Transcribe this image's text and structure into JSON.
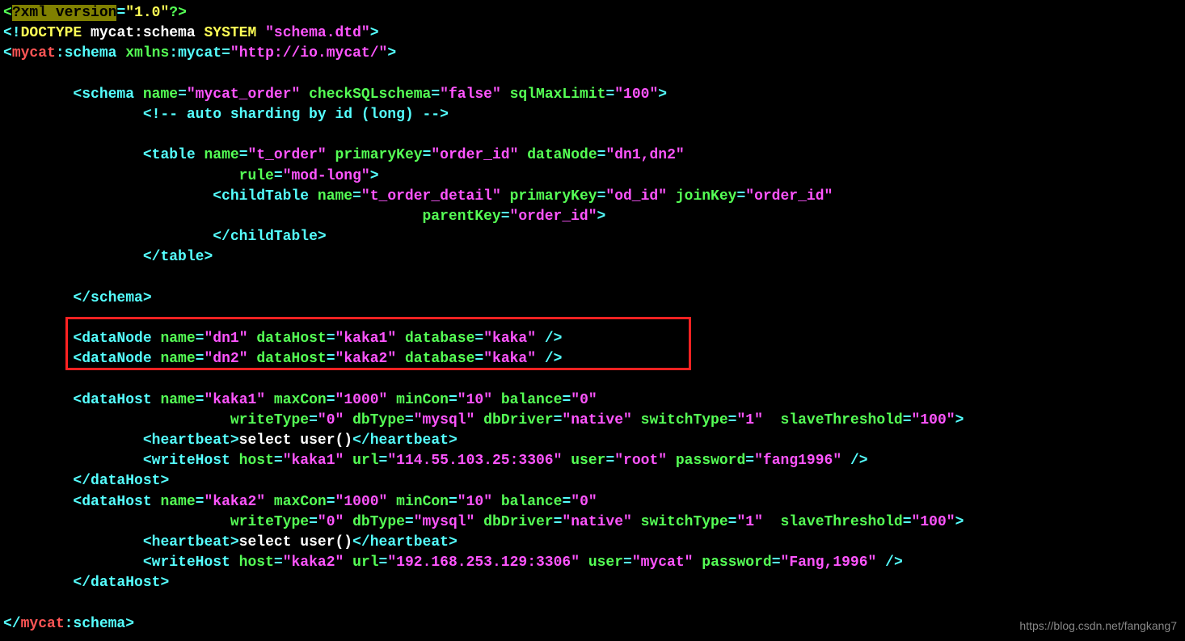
{
  "line1": {
    "t1": "<",
    "t2": "?",
    "t3": "xml version",
    "t4": "=",
    "t5": "\"1.0\"",
    "t6": "?>"
  },
  "line2": {
    "t1": "<!",
    "t2": "DOCTYPE",
    "t3": " mycat:schema ",
    "t4": "SYSTEM",
    "t5": " ",
    "t6": "\"schema.dtd\"",
    "t7": ">"
  },
  "line3": {
    "t1": "<",
    "t2": "mycat",
    "t3": ":schema ",
    "t4": "xmlns",
    "t5": ":mycat=",
    "t6": "\"http://io.mycat/\"",
    "t7": ">"
  },
  "line5": {
    "t1": "        <",
    "t2": "schema",
    "t3": " ",
    "t4": "name",
    "t5": "=",
    "t6": "\"mycat_order\"",
    "t7": " ",
    "t8": "checkSQLschema",
    "t9": "=",
    "t10": "\"false\"",
    "t11": " ",
    "t12": "sqlMaxLimit",
    "t13": "=",
    "t14": "\"100\"",
    "t15": ">"
  },
  "line6": {
    "t1": "                ",
    "t2": "<!-- auto sharding by id (long) -->"
  },
  "line8": {
    "t1": "                <",
    "t2": "table",
    "t3": " ",
    "t4": "name",
    "t5": "=",
    "t6": "\"t_order\"",
    "t7": " ",
    "t8": "primaryKey",
    "t9": "=",
    "t10": "\"order_id\"",
    "t11": " ",
    "t12": "dataNode",
    "t13": "=",
    "t14": "\"dn1,dn2\""
  },
  "line9": {
    "t1": "                           ",
    "t2": "rule",
    "t3": "=",
    "t4": "\"mod-long\"",
    "t5": ">"
  },
  "line10": {
    "t1": "                        <",
    "t2": "childTable",
    "t3": " ",
    "t4": "name",
    "t5": "=",
    "t6": "\"t_order_detail\"",
    "t7": " ",
    "t8": "primaryKey",
    "t9": "=",
    "t10": "\"od_id\"",
    "t11": " ",
    "t12": "joinKey",
    "t13": "=",
    "t14": "\"order_id\""
  },
  "line11": {
    "t1": "                                                ",
    "t2": "parentKey",
    "t3": "=",
    "t4": "\"order_id\"",
    "t5": ">"
  },
  "line12": {
    "t1": "                        </",
    "t2": "childTable",
    "t3": ">"
  },
  "line13": {
    "t1": "                </",
    "t2": "table",
    "t3": ">"
  },
  "line15": {
    "t1": "        </",
    "t2": "schema",
    "t3": ">"
  },
  "line17": {
    "t1": "        <",
    "t2": "dataNode",
    "t3": " ",
    "t4": "name",
    "t5": "=",
    "t6": "\"dn1\"",
    "t7": " ",
    "t8": "dataHost",
    "t9": "=",
    "t10": "\"kaka1\"",
    "t11": " ",
    "t12": "database",
    "t13": "=",
    "t14": "\"kaka\"",
    "t15": " />"
  },
  "line18": {
    "t1": "        <",
    "t2": "dataNode",
    "t3": " ",
    "t4": "name",
    "t5": "=",
    "t6": "\"dn2\"",
    "t7": " ",
    "t8": "dataHost",
    "t9": "=",
    "t10": "\"kaka2\"",
    "t11": " ",
    "t12": "database",
    "t13": "=",
    "t14": "\"kaka\"",
    "t15": " />"
  },
  "line20": {
    "t1": "        <",
    "t2": "dataHost",
    "t3": " ",
    "t4": "name",
    "t5": "=",
    "t6": "\"kaka1\"",
    "t7": " ",
    "t8": "maxCon",
    "t9": "=",
    "t10": "\"1000\"",
    "t11": " ",
    "t12": "minCon",
    "t13": "=",
    "t14": "\"10\"",
    "t15": " ",
    "t16": "balance",
    "t17": "=",
    "t18": "\"0\""
  },
  "line21": {
    "t1": "                          ",
    "t2": "writeType",
    "t3": "=",
    "t4": "\"0\"",
    "t5": " ",
    "t6": "dbType",
    "t7": "=",
    "t8": "\"mysql\"",
    "t9": " ",
    "t10": "dbDriver",
    "t11": "=",
    "t12": "\"native\"",
    "t13": " ",
    "t14": "switchType",
    "t15": "=",
    "t16": "\"1\"",
    "t17": "  ",
    "t18": "slaveThreshold",
    "t19": "=",
    "t20": "\"100\"",
    "t21": ">"
  },
  "line22": {
    "t1": "                <",
    "t2": "heartbeat",
    "t3": ">",
    "t4": "select user()",
    "t5": "</",
    "t6": "heartbeat",
    "t7": ">"
  },
  "line23": {
    "t1": "                <",
    "t2": "writeHost",
    "t3": " ",
    "t4": "host",
    "t5": "=",
    "t6": "\"kaka1\"",
    "t7": " ",
    "t8": "url",
    "t9": "=",
    "t10": "\"114.55.103.25:3306\"",
    "t11": " ",
    "t12": "user",
    "t13": "=",
    "t14": "\"root\"",
    "t15": " ",
    "t16": "password",
    "t17": "=",
    "t18": "\"fang1996\"",
    "t19": " />"
  },
  "line24": {
    "t1": "        </",
    "t2": "dataHost",
    "t3": ">"
  },
  "line25": {
    "t1": "        <",
    "t2": "dataHost",
    "t3": " ",
    "t4": "name",
    "t5": "=",
    "t6": "\"kaka2\"",
    "t7": " ",
    "t8": "maxCon",
    "t9": "=",
    "t10": "\"1000\"",
    "t11": " ",
    "t12": "minCon",
    "t13": "=",
    "t14": "\"10\"",
    "t15": " ",
    "t16": "balance",
    "t17": "=",
    "t18": "\"0\""
  },
  "line26": {
    "t1": "                          ",
    "t2": "writeType",
    "t3": "=",
    "t4": "\"0\"",
    "t5": " ",
    "t6": "dbType",
    "t7": "=",
    "t8": "\"mysql\"",
    "t9": " ",
    "t10": "dbDriver",
    "t11": "=",
    "t12": "\"native\"",
    "t13": " ",
    "t14": "switchType",
    "t15": "=",
    "t16": "\"1\"",
    "t17": "  ",
    "t18": "slaveThreshold",
    "t19": "=",
    "t20": "\"100\"",
    "t21": ">"
  },
  "line27": {
    "t1": "                <",
    "t2": "heartbeat",
    "t3": ">",
    "t4": "select user()",
    "t5": "</",
    "t6": "heartbeat",
    "t7": ">"
  },
  "line28": {
    "t1": "                <",
    "t2": "writeHost",
    "t3": " ",
    "t4": "host",
    "t5": "=",
    "t6": "\"kaka2\"",
    "t7": " ",
    "t8": "url",
    "t9": "=",
    "t10": "\"192.168.253.129:3306\"",
    "t11": " ",
    "t12": "user",
    "t13": "=",
    "t14": "\"mycat\"",
    "t15": " ",
    "t16": "password",
    "t17": "=",
    "t18": "\"Fang,1996\"",
    "t19": " />"
  },
  "line29": {
    "t1": "        </",
    "t2": "dataHost",
    "t3": ">"
  },
  "line31": {
    "t1": "</",
    "t2": "mycat",
    "t3": ":schema",
    "t4": ">"
  },
  "watermark": "https://blog.csdn.net/fangkang7"
}
